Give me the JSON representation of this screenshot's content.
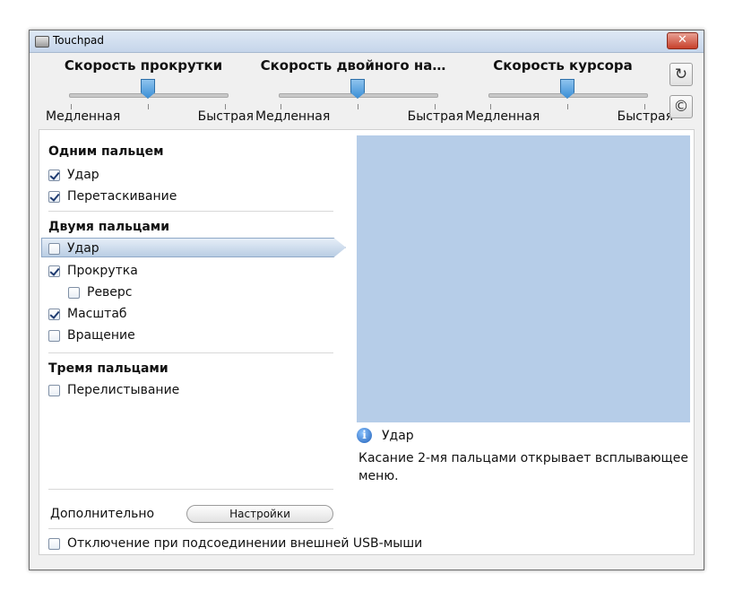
{
  "window": {
    "title": "Touchpad",
    "close_label": "✕"
  },
  "sliders": [
    {
      "title": "Скорость прокрутки",
      "slow": "Медленная",
      "fast": "Быстрая",
      "value": 0.5
    },
    {
      "title": "Скорость двойного на…",
      "slow": "Медленная",
      "fast": "Быстрая",
      "value": 0.5
    },
    {
      "title": "Скорость курсора",
      "slow": "Медленная",
      "fast": "Быстрая",
      "value": 0.5
    }
  ],
  "toolbar": {
    "reset_glyph": "↻",
    "about_glyph": "©"
  },
  "sections": {
    "one_finger": {
      "title": "Одним пальцем",
      "tap": "Удар",
      "drag": "Перетаскивание"
    },
    "two_fingers": {
      "title": "Двумя пальцами",
      "tap": "Удар",
      "scroll": "Прокрутка",
      "reverse": "Реверс",
      "zoom": "Масштаб",
      "rotate": "Вращение"
    },
    "three_fingers": {
      "title": "Тремя пальцами",
      "swipe": "Перелистывание"
    }
  },
  "checks": {
    "one_tap": true,
    "one_drag": true,
    "two_tap": false,
    "two_scroll": true,
    "two_reverse": false,
    "two_zoom": true,
    "two_rotate": false,
    "three_swipe": false,
    "disable_usb": false
  },
  "info": {
    "icon": "i",
    "title": "Удар",
    "description": "Касание 2-мя пальцами открывает всплывающее меню."
  },
  "footer": {
    "advanced_label": "Дополнительно",
    "settings_button": "Настройки",
    "disable_usb": "Отключение при подсоединении внешней USB-мыши"
  },
  "colors": {
    "preview": "#b6cde8",
    "accent": "#3c8fd6"
  }
}
